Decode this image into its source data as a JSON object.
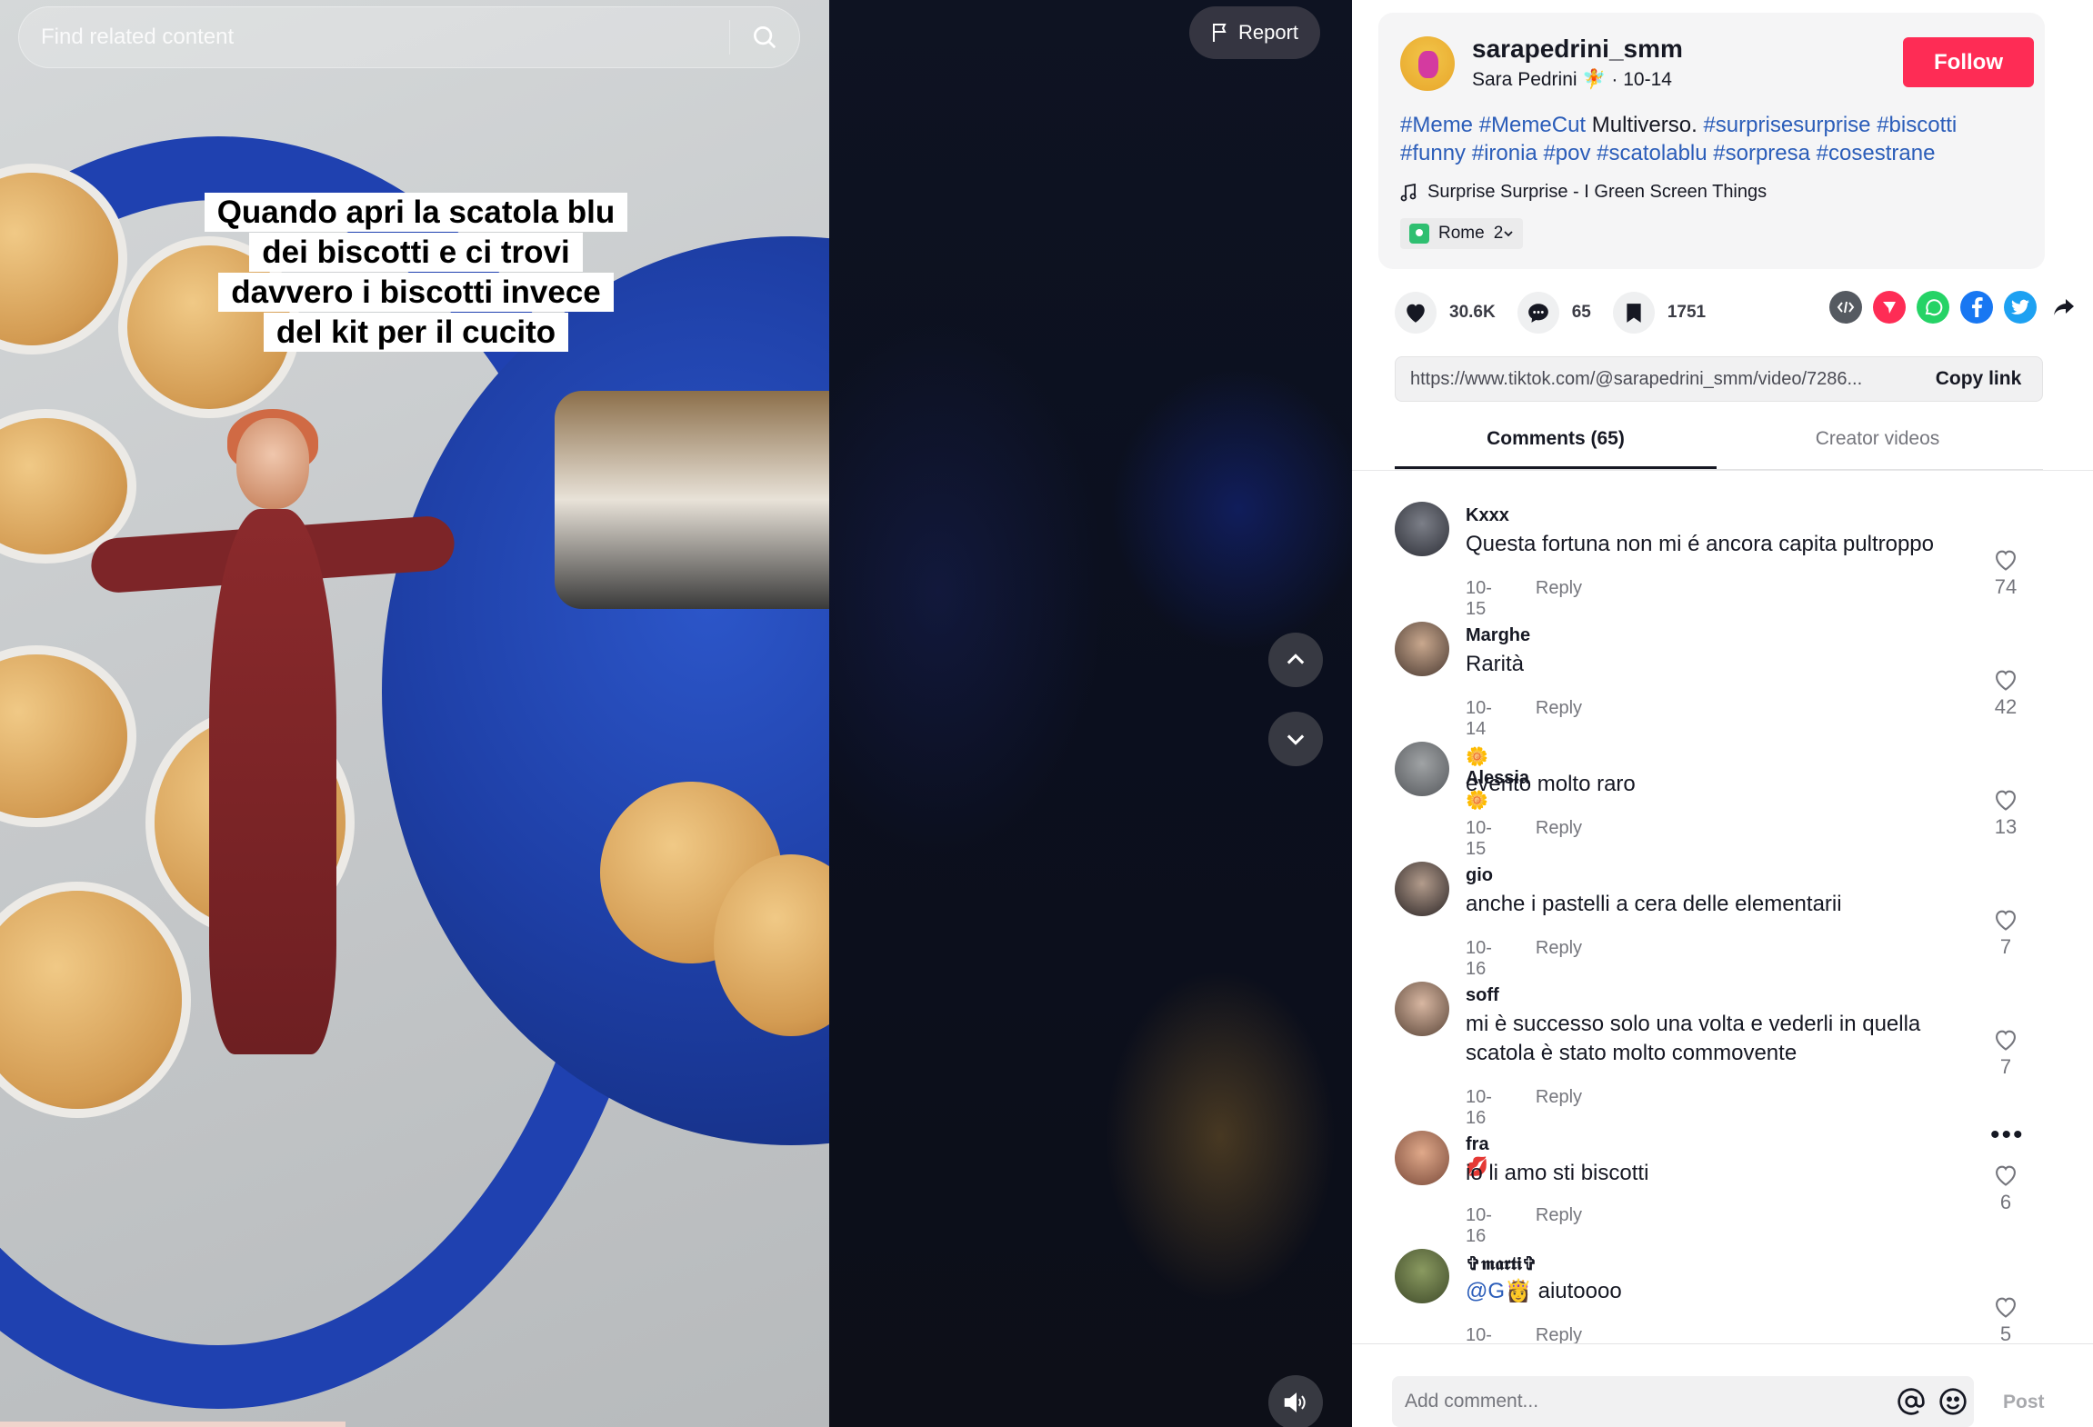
{
  "search": {
    "placeholder": "Find related content"
  },
  "video": {
    "caption_lines": [
      "Quando apri la scatola blu",
      "dei biscotti e ci trovi",
      "davvero i biscotti invece",
      "del kit per il cucito"
    ],
    "report_label": "Report"
  },
  "author": {
    "username": "sarapedrini_smm",
    "display_name": "Sara Pedrini 🧚",
    "date": "10-14",
    "follow_label": "Follow"
  },
  "description": {
    "tags_before": [
      "#Meme",
      "#MemeCut"
    ],
    "text": "Multiverso.",
    "tags_after": [
      "#surprisesurprise",
      "#biscotti",
      "#funny",
      "#ironia",
      "#pov",
      "#scatolablu",
      "#sorpresa",
      "#cosestrane"
    ]
  },
  "music": "Surprise Surprise - I Green Screen Things",
  "location": {
    "name": "Rome",
    "count": "2"
  },
  "stats": {
    "likes": "30.6K",
    "comments": "65",
    "saves": "1751"
  },
  "share_colors": {
    "embed": "#555a61",
    "send": "#fe2c55",
    "whatsapp": "#25d366",
    "facebook": "#1877f2",
    "twitter": "#1da1f2"
  },
  "link": {
    "url": "https://www.tiktok.com/@sarapedrini_smm/video/7286...",
    "copy_label": "Copy link"
  },
  "tabs": [
    {
      "label": "Comments (65)"
    },
    {
      "label": "Creator videos"
    }
  ],
  "comments": [
    {
      "user": "Kxxx",
      "text": "Questa fortuna non mi é ancora capita pultroppo",
      "date": "10-15",
      "reply": "Reply",
      "likes": "74"
    },
    {
      "user": "Marghe",
      "text": "Rarità",
      "date": "10-14",
      "reply": "Reply",
      "likes": "42"
    },
    {
      "user": "🌼Alessia🌼",
      "text": "evento molto raro",
      "date": "10-15",
      "reply": "Reply",
      "likes": "13"
    },
    {
      "user": "gio",
      "text": "anche i pastelli a cera delle elementarii",
      "date": "10-16",
      "reply": "Reply",
      "likes": "7"
    },
    {
      "user": "soff",
      "text": "mi è successo solo una volta e vederli in quella scatola è stato molto commovente",
      "date": "10-16",
      "reply": "Reply",
      "likes": "7"
    },
    {
      "user": "fra💋",
      "text": "io li amo sti biscotti",
      "date": "10-16",
      "reply": "Reply",
      "likes": "6"
    },
    {
      "user": "✞𝖒𝖆𝖗𝖙𝖎✞",
      "mention": "@G👸",
      "text": "aiutoooo",
      "date": "10-16",
      "reply": "Reply",
      "likes": "5"
    }
  ],
  "composer": {
    "placeholder": "Add comment...",
    "post_label": "Post"
  }
}
